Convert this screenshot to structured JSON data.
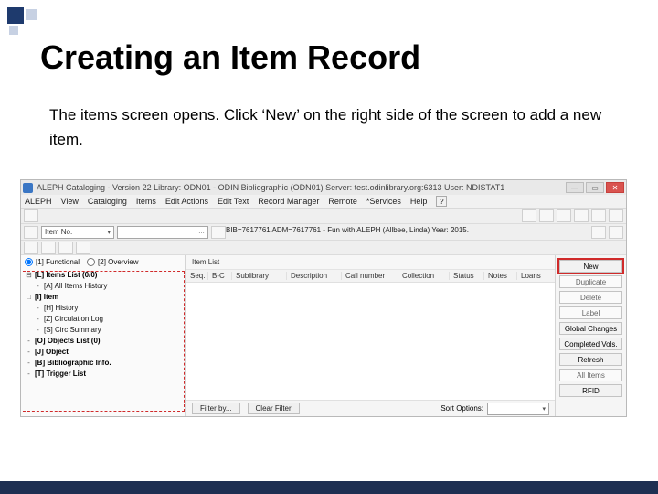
{
  "slide": {
    "title": "Creating an Item Record",
    "body": "The items screen opens.  Click ‘New’ on the right side of the screen to add a new item."
  },
  "app": {
    "title": "ALEPH Cataloging - Version 22  Library: ODN01 - ODIN Bibliographic (ODN01)  Server: test.odinlibrary.org:6313   User: NDISTAT1",
    "menu": [
      "ALEPH",
      "View",
      "Cataloging",
      "Items",
      "Edit Actions",
      "Edit Text",
      "Record Manager",
      "Remote",
      "*Services",
      "Help"
    ],
    "help_icon": "?",
    "combo_label": "Item No.",
    "bib_info": "BIB=7617761 ADM=7617761 - Fun with ALEPH (Allbee, Linda) Year: 2015.",
    "radios": {
      "functional": "[1] Functional",
      "overview": "[2] Overview"
    },
    "tree": [
      {
        "level": 0,
        "icon": "⊟",
        "bold": true,
        "label": "[L] Items List (0/0)"
      },
      {
        "level": 1,
        "icon": "-",
        "bold": false,
        "label": "[A] All Items History"
      },
      {
        "level": 0,
        "icon": "□",
        "bold": true,
        "label": "[I] Item"
      },
      {
        "level": 1,
        "icon": "-",
        "bold": false,
        "label": "[H] History"
      },
      {
        "level": 1,
        "icon": "-",
        "bold": false,
        "label": "[Z] Circulation Log"
      },
      {
        "level": 1,
        "icon": "-",
        "bold": false,
        "label": "[S] Circ Summary"
      },
      {
        "level": 0,
        "icon": "-",
        "bold": true,
        "label": "[O] Objects List (0)"
      },
      {
        "level": 0,
        "icon": "-",
        "bold": true,
        "label": "[J] Object"
      },
      {
        "level": 0,
        "icon": "-",
        "bold": true,
        "label": "[B] Bibliographic Info."
      },
      {
        "level": 0,
        "icon": "-",
        "bold": true,
        "label": "[T] Trigger List"
      }
    ],
    "pane_title": "Item List",
    "columns": [
      "Seq.",
      "B-C",
      "Sublibrary",
      "Description",
      "Call number",
      "Collection",
      "Status",
      "Notes",
      "Loans"
    ],
    "filter": {
      "by": "Filter by...",
      "clear": "Clear Filter",
      "sort_label": "Sort Options:"
    },
    "right_buttons": [
      {
        "label": "New",
        "enabled": true,
        "highlight": true
      },
      {
        "label": "Duplicate",
        "enabled": false,
        "highlight": false
      },
      {
        "label": "Delete",
        "enabled": false,
        "highlight": false
      },
      {
        "label": "Label",
        "enabled": false,
        "highlight": false
      },
      {
        "label": "Global Changes",
        "enabled": true,
        "highlight": false
      },
      {
        "label": "Completed Vols.",
        "enabled": true,
        "highlight": false
      },
      {
        "label": "Refresh",
        "enabled": true,
        "highlight": false
      },
      {
        "label": "All Items",
        "enabled": false,
        "highlight": false
      },
      {
        "label": "RFID",
        "enabled": true,
        "highlight": false
      }
    ]
  }
}
